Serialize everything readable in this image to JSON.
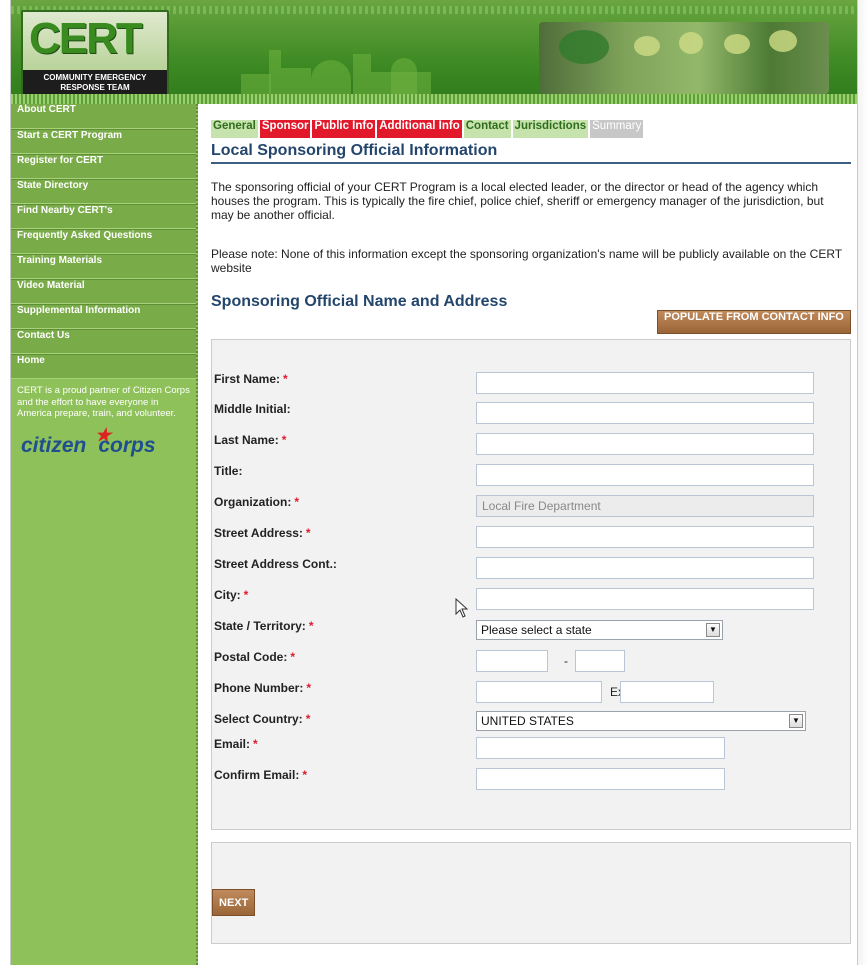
{
  "header": {
    "logo_big": "CERT",
    "logo_line1": "COMMUNITY EMERGENCY",
    "logo_line2": "RESPONSE TEAM"
  },
  "sidebar": {
    "items": [
      {
        "label": "About CERT"
      },
      {
        "label": "Start a CERT Program"
      },
      {
        "label": "Register for CERT"
      },
      {
        "label": "State Directory"
      },
      {
        "label": "Find Nearby CERT's"
      },
      {
        "label": "Frequently Asked Questions"
      },
      {
        "label": "Training Materials"
      },
      {
        "label": "Video Material"
      },
      {
        "label": "Supplemental Information"
      },
      {
        "label": "Contact Us"
      },
      {
        "label": "Home"
      }
    ],
    "partner_text": "CERT is a proud partner of Citizen Corps and the effort to have everyone in America prepare, train, and volunteer.",
    "partner_logo_a": "citizen",
    "partner_logo_b": "corps"
  },
  "tabs": [
    {
      "label": "General"
    },
    {
      "label": "Sponsor"
    },
    {
      "label": "Public Info"
    },
    {
      "label": "Additional Info"
    },
    {
      "label": "Contact"
    },
    {
      "label": "Jurisdictions"
    },
    {
      "label": "Summary"
    }
  ],
  "page": {
    "title": "Local Sponsoring Official Information",
    "intro": "The sponsoring official of your CERT Program is a local elected leader, or the director or head of the agency which houses the program. This is typically the fire chief, police chief, sheriff or emergency manager of the jurisdiction, but may be another official.",
    "note": "Please note: None of this information except the sponsoring organization's name will be publicly available on the CERT website",
    "section_title": "Sponsoring Official Name and Address",
    "populate_label": "POPULATE FROM CONTACT INFO",
    "next_label": "NEXT"
  },
  "form": {
    "first_name": {
      "label": "First Name:",
      "value": ""
    },
    "middle_initial": {
      "label": "Middle Initial:",
      "value": ""
    },
    "last_name": {
      "label": "Last Name:",
      "value": ""
    },
    "title": {
      "label": "Title:",
      "value": ""
    },
    "organization": {
      "label": "Organization:",
      "value": "Local Fire Department"
    },
    "street": {
      "label": "Street Address:",
      "value": ""
    },
    "street_cont": {
      "label": "Street Address Cont.:",
      "value": ""
    },
    "city": {
      "label": "City:",
      "value": ""
    },
    "state": {
      "label": "State / Territory:",
      "selected": "Please select a state"
    },
    "postal": {
      "label": "Postal Code:",
      "dash": "-"
    },
    "phone": {
      "label": "Phone Number:",
      "ext_label": "Ext:"
    },
    "country": {
      "label": "Select Country:",
      "selected": "UNITED STATES"
    },
    "email": {
      "label": "Email:",
      "value": ""
    },
    "confirm_email": {
      "label": "Confirm Email:",
      "value": ""
    },
    "required_mark": "*"
  }
}
